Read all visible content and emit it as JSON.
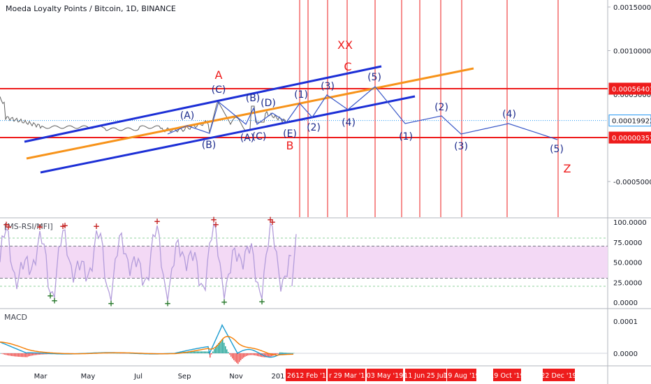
{
  "header": {
    "title": "Moeda Loyalty Points / Bitcoin, 1D, BINANCE",
    "rsi_title": "[MS-RSI/MFI]",
    "macd_title": "MACD"
  },
  "colors": {
    "channel": "#1c2fd6",
    "orange": "#f7931a",
    "red": "#ee1c1c",
    "wave": "#3a58c8",
    "wave_label": "#1b2a8c",
    "price": "#606060",
    "rsi_band": "#f3d9f5",
    "macd_line": "#1a9bd0",
    "signal_line": "#f57c00",
    "up_hist": "#26a69a",
    "down_hist": "#ef5350"
  },
  "chart_data": [
    {
      "type": "line",
      "name": "price_panel",
      "y_tick_labels": [
        "0.00150000",
        "0.00100000",
        "0.00050000",
        "0.00000000",
        "-0.00050000"
      ],
      "y_ticks": [
        0.0015,
        0.001,
        0.0005,
        0.0,
        -0.0005
      ],
      "ylim": [
        -0.00075,
        0.00162
      ],
      "price_badges": [
        {
          "label": "0.00056401",
          "value": 0.00056401,
          "style": "red"
        },
        {
          "label": "0.00019922",
          "value": 0.00019922,
          "style": "blue"
        },
        {
          "label": "0.00000352",
          "value": 3.52e-06,
          "style": "red"
        }
      ],
      "elliott_labels": [
        "(A)",
        "(B)",
        "(C)",
        "(A)",
        "(B)",
        "(C)",
        "(D)",
        "(E)",
        "(1)",
        "(2)",
        "(3)",
        "(4)",
        "(5)",
        "(1)",
        "(2)",
        "(3)",
        "(4)",
        "(5)"
      ],
      "red_labels": [
        "A",
        "B",
        "C",
        "XX",
        "Z"
      ]
    },
    {
      "type": "line",
      "name": "rsi_panel",
      "title": "[MS-RSI/MFI]",
      "y_tick_labels": [
        "100.0000",
        "75.0000",
        "50.0000",
        "25.0000",
        "0.0000"
      ],
      "y_ticks": [
        100,
        75,
        50,
        25,
        0
      ],
      "ylim": [
        -2,
        104
      ],
      "band": [
        30,
        70
      ]
    },
    {
      "type": "line",
      "name": "macd_panel",
      "title": "MACD",
      "y_tick_labels": [
        "0.0001",
        "0.0000"
      ],
      "y_ticks": [
        0.0001,
        0.0
      ],
      "ylim": [
        -2.25e-05,
        0.000112
      ]
    }
  ],
  "x_axis": {
    "labels": [
      "Mar",
      "May",
      "Jul",
      "Sep",
      "Nov",
      "201"
    ],
    "date_badges": [
      "26 .",
      "12 Feb '19",
      "r",
      "29 Mar '1",
      "03 May '19",
      "11 Jun '19",
      "25 Jul",
      "19 Aug '19",
      "19 Oct '19",
      "22 Dec '19"
    ]
  }
}
